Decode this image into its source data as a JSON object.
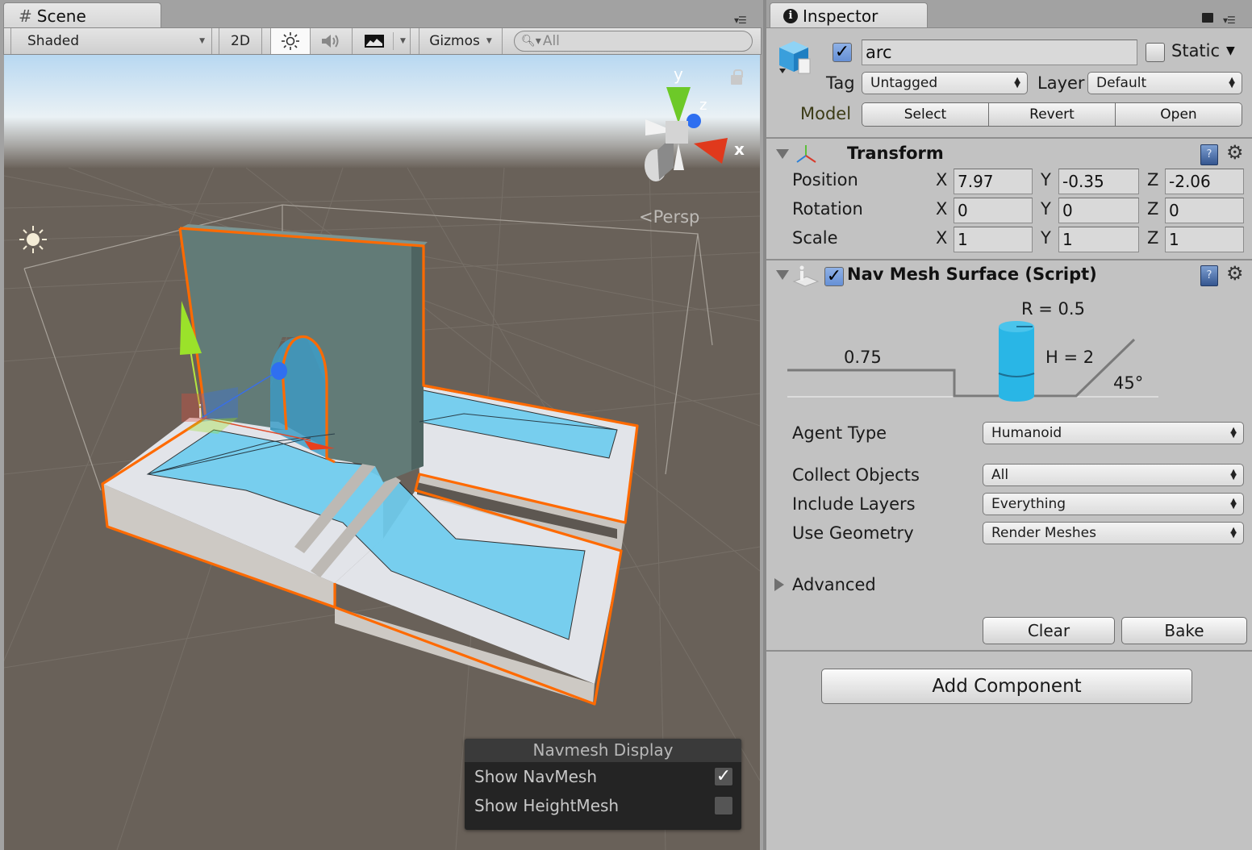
{
  "scene": {
    "tab_label": "Scene",
    "toolbar": {
      "shading_mode": "Shaded",
      "mode_2d": "2D",
      "gizmos_label": "Gizmos",
      "search_placeholder": "All"
    },
    "viewport": {
      "projection_label": "Persp",
      "gizmo_axes": {
        "x": "x",
        "y": "y",
        "z": "z"
      },
      "colors": {
        "selection_outline": "#ff6a00",
        "navmesh": "#6fcdef",
        "wall": "#627b77",
        "ground": "#696159"
      }
    },
    "navmesh_display": {
      "title": "Navmesh Display",
      "options": [
        {
          "label": "Show NavMesh",
          "checked": true
        },
        {
          "label": "Show HeightMesh",
          "checked": false
        }
      ]
    }
  },
  "inspector": {
    "tab_label": "Inspector",
    "object": {
      "active": true,
      "name": "arc",
      "static_label": "Static",
      "static": false,
      "tag_label": "Tag",
      "tag_value": "Untagged",
      "layer_label": "Layer",
      "layer_value": "Default",
      "model_label": "Model",
      "model_buttons": [
        "Select",
        "Revert",
        "Open"
      ]
    },
    "transform": {
      "title": "Transform",
      "rows": [
        {
          "label": "Position",
          "x": "7.97",
          "y": "-0.35",
          "z": "-2.06"
        },
        {
          "label": "Rotation",
          "x": "0",
          "y": "0",
          "z": "0"
        },
        {
          "label": "Scale",
          "x": "1",
          "y": "1",
          "z": "1"
        }
      ],
      "axis_labels": [
        "X",
        "Y",
        "Z"
      ]
    },
    "navmesh_surface": {
      "title": "Nav Mesh Surface (Script)",
      "enabled": true,
      "diagram": {
        "radius_label": "R = 0.5",
        "height_label": "H = 2",
        "step_label": "0.75",
        "slope_label": "45°",
        "agent_color": "#29b6e6"
      },
      "fields": [
        {
          "label": "Agent Type",
          "value": "Humanoid"
        },
        {
          "label": "Collect Objects",
          "value": "All"
        },
        {
          "label": "Include Layers",
          "value": "Everything"
        },
        {
          "label": "Use Geometry",
          "value": "Render Meshes"
        }
      ],
      "advanced_label": "Advanced",
      "clear_label": "Clear",
      "bake_label": "Bake"
    },
    "add_component_label": "Add Component"
  }
}
